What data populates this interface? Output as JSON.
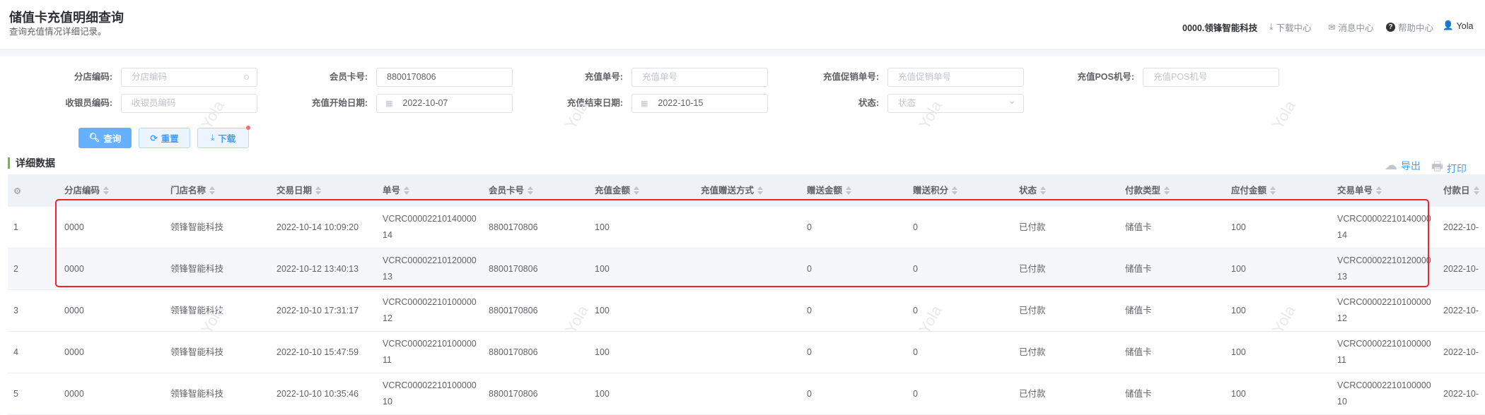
{
  "header": {
    "title": "储值卡充值明细查询",
    "subtitle": "查询充值情况详细记录。",
    "org": "0000.领锋智能科技",
    "nav": [
      {
        "label": "下载中心",
        "icon": "download-icon"
      },
      {
        "label": "消息中心",
        "icon": "message-icon"
      },
      {
        "label": "帮助中心",
        "icon": "help-icon"
      },
      {
        "label": "Yola",
        "icon": "user-icon"
      }
    ]
  },
  "filters": {
    "row1": [
      {
        "label": "分店编码:",
        "value": "",
        "placeholder": "分店编码"
      },
      {
        "label": "会员卡号:",
        "value": "8800170806",
        "placeholder": ""
      },
      {
        "label": "充值单号:",
        "value": "",
        "placeholder": "充值单号"
      },
      {
        "label": "充值促销单号:",
        "value": "",
        "placeholder": "充值促销单号"
      },
      {
        "label": "充值POS机号:",
        "value": "",
        "placeholder": "充值POS机号"
      }
    ],
    "row2": [
      {
        "label": "收银员编码:",
        "value": "",
        "placeholder": "收银员编码"
      },
      {
        "label": "充值开始日期:",
        "value": "2022-10-07",
        "placeholder": ""
      },
      {
        "label": "充值结束日期:",
        "value": "2022-10-15",
        "placeholder": ""
      },
      {
        "label": "状态:",
        "value": "",
        "placeholder": "状态"
      }
    ],
    "buttons": {
      "query": "查询",
      "reset": "重置",
      "download": "下载"
    }
  },
  "section": {
    "title": "详细数据",
    "export": "导出",
    "print": "打印"
  },
  "table": {
    "columns": [
      "分店编码",
      "门店名称",
      "交易日期",
      "单号",
      "会员卡号",
      "充值金额",
      "充值赠送方式",
      "赠送金额",
      "赠送积分",
      "状态",
      "付款类型",
      "应付金额",
      "交易单号",
      "付款日"
    ],
    "rows": [
      [
        "1",
        "0000",
        "领锋智能科技",
        "2022-10-14 10:09:20",
        "VCRC0000221014000014",
        "8800170806",
        "100",
        "",
        "0",
        "0",
        "已付款",
        "储值卡",
        "100",
        "VCRC0000221014000014",
        "2022-10-"
      ],
      [
        "2",
        "0000",
        "领锋智能科技",
        "2022-10-12 13:40:13",
        "VCRC0000221012000013",
        "8800170806",
        "100",
        "",
        "0",
        "0",
        "已付款",
        "储值卡",
        "100",
        "VCRC0000221012000013",
        "2022-10-"
      ],
      [
        "3",
        "0000",
        "领锋智能科技",
        "2022-10-10 17:31:17",
        "VCRC0000221010000012",
        "8800170806",
        "100",
        "",
        "0",
        "0",
        "已付款",
        "储值卡",
        "100",
        "VCRC0000221010000012",
        "2022-10-"
      ],
      [
        "4",
        "0000",
        "领锋智能科技",
        "2022-10-10 15:47:59",
        "VCRC0000221010000011",
        "8800170806",
        "100",
        "",
        "0",
        "0",
        "已付款",
        "储值卡",
        "100",
        "VCRC0000221010000011",
        "2022-10-"
      ],
      [
        "5",
        "0000",
        "领锋智能科技",
        "2022-10-10 10:35:46",
        "VCRC0000221010000010",
        "8800170806",
        "100",
        "",
        "0",
        "0",
        "已付款",
        "储值卡",
        "100",
        "VCRC0000221010000010",
        "2022-10-"
      ]
    ]
  },
  "watermark": "Yola",
  "colors": {
    "primary": "#409eff",
    "highlight": "#f5222d",
    "section_bar": "#67c23a"
  }
}
